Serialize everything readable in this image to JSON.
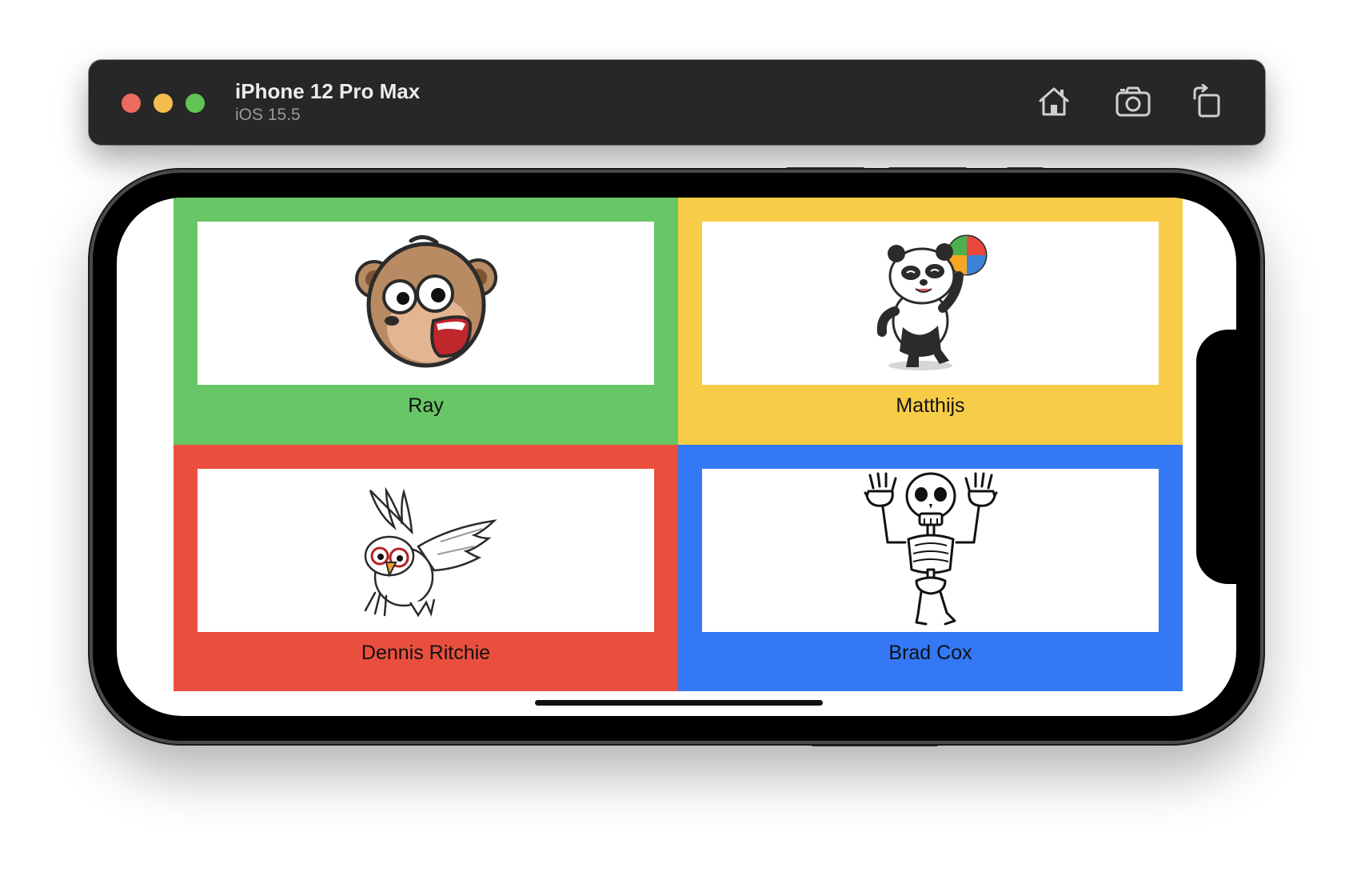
{
  "window": {
    "device_name": "iPhone 12 Pro Max",
    "os_version": "iOS 15.5",
    "toolbar_icons": [
      "home-icon",
      "screenshot-icon",
      "rotate-icon"
    ]
  },
  "app": {
    "cells": [
      {
        "label": "Ray",
        "color": "#67c666",
        "image": "monkey-icon"
      },
      {
        "label": "Matthijs",
        "color": "#f7cd47",
        "image": "panda-icon"
      },
      {
        "label": "Dennis Ritchie",
        "color": "#ea4f3d",
        "image": "owl-icon"
      },
      {
        "label": "Brad Cox",
        "color": "#3478f6",
        "image": "skeleton-icon"
      }
    ]
  }
}
